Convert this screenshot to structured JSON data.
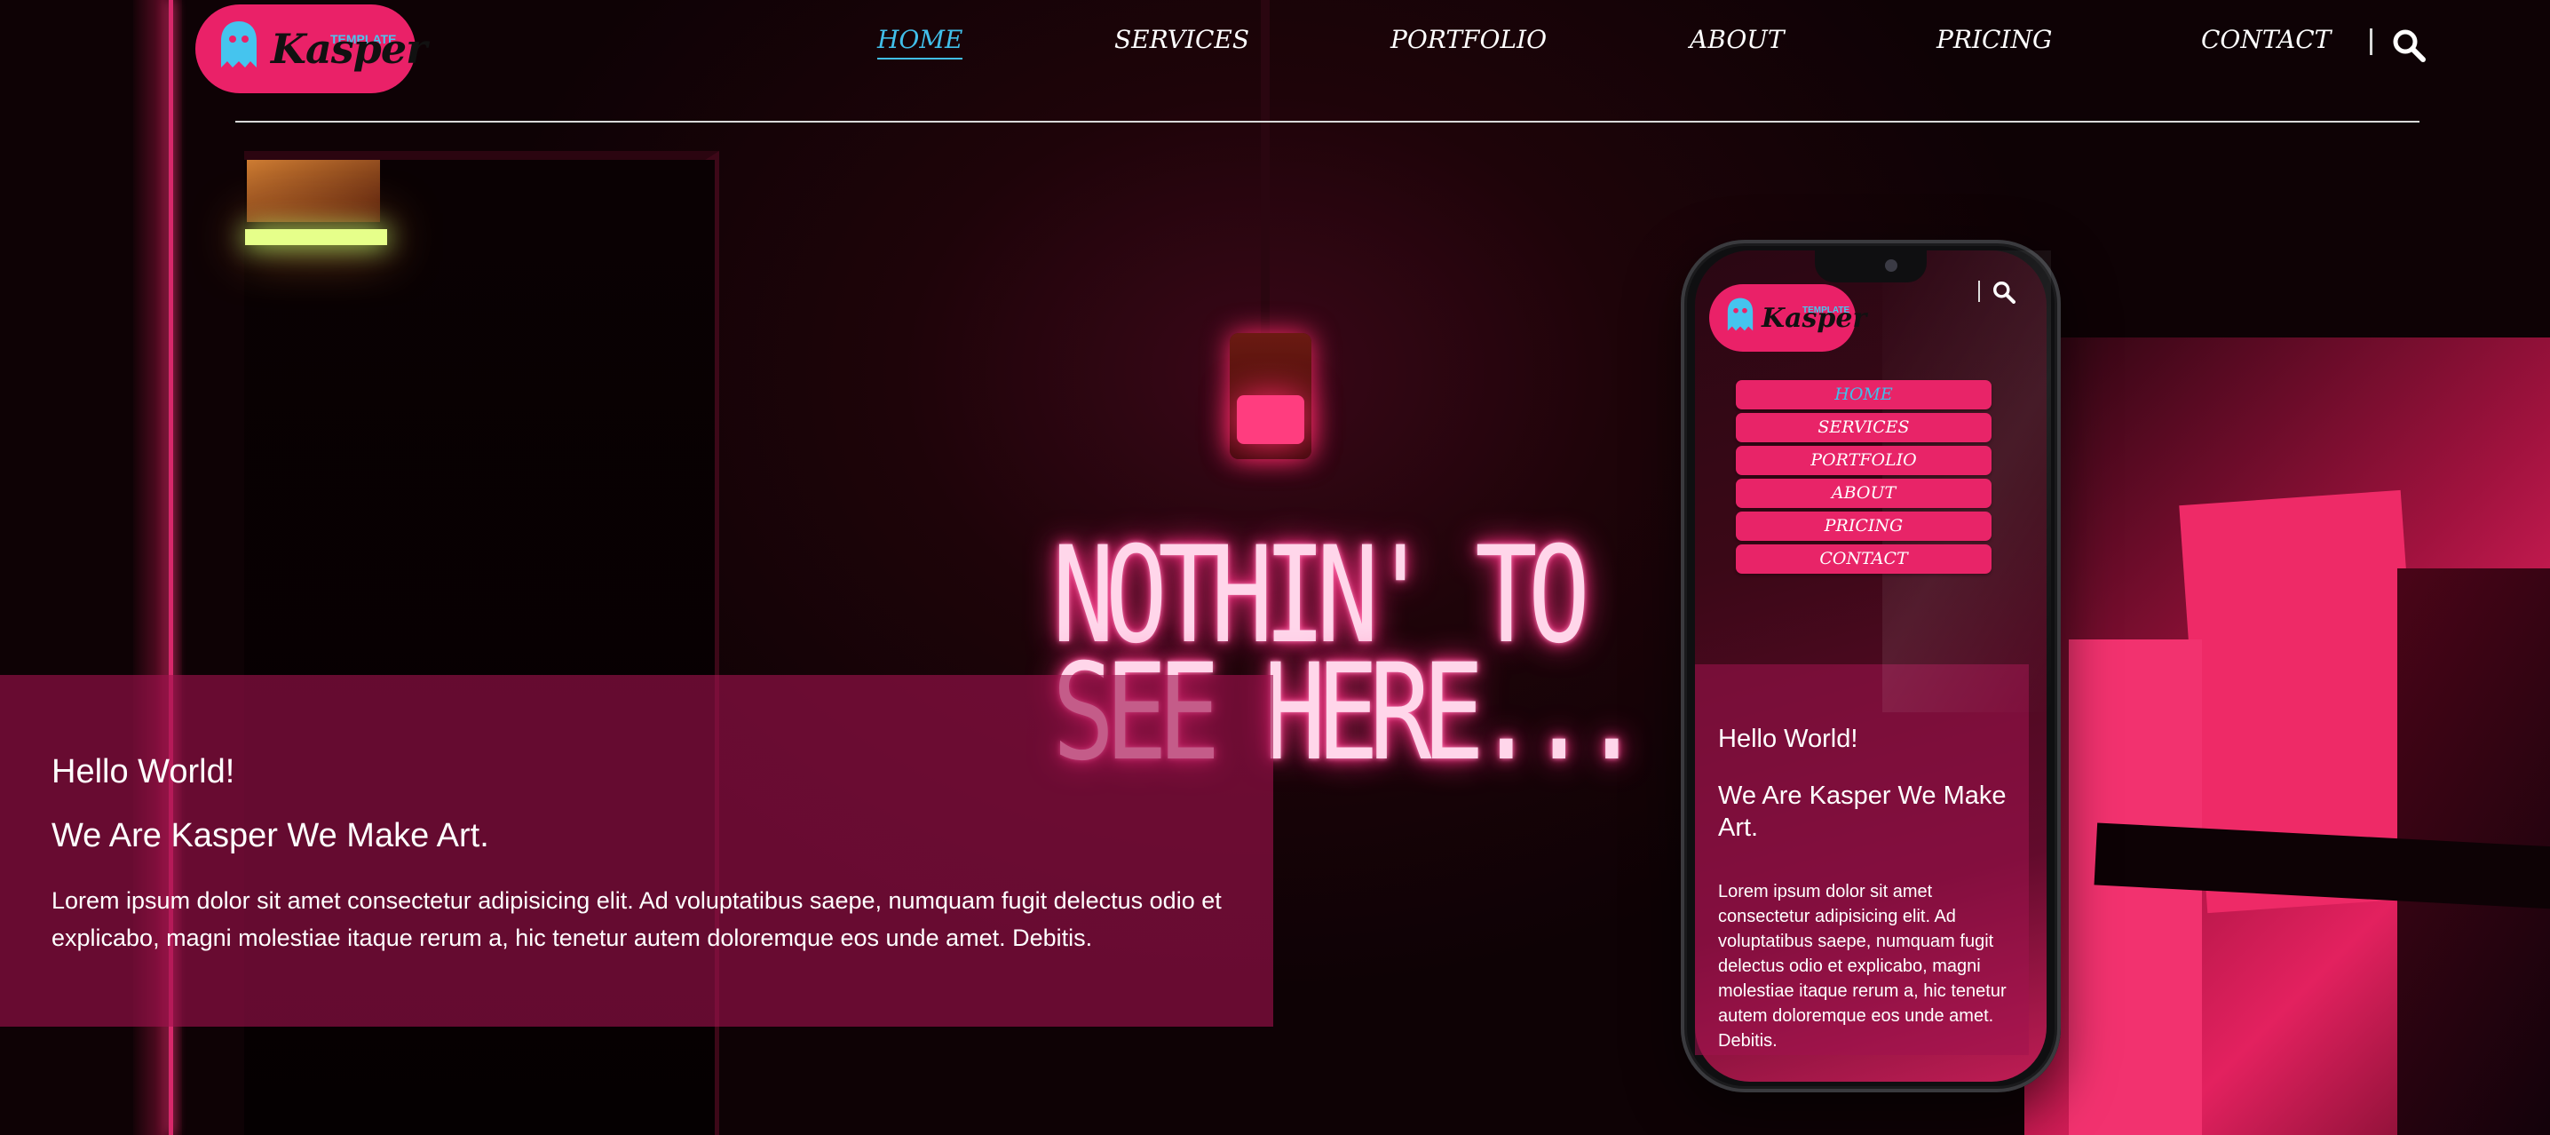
{
  "logo": {
    "name": "Kasper",
    "tag": "TEMPLATE"
  },
  "nav": {
    "items": [
      {
        "label": "HOME",
        "active": true
      },
      {
        "label": "SERVICES"
      },
      {
        "label": "PORTFOLIO"
      },
      {
        "label": "ABOUT"
      },
      {
        "label": "PRICING"
      },
      {
        "label": "CONTACT"
      }
    ],
    "search_icon": "search-icon"
  },
  "neon_sign": {
    "line1": "NOTHIN' TO",
    "line2": "SEE HERE..."
  },
  "intro": {
    "heading1": "Hello World!",
    "heading2": "We Are Kasper We Make Art.",
    "paragraph": "Lorem ipsum dolor sit amet consectetur adipisicing elit. Ad voluptatibus saepe, numquam fugit delectus odio et explicabo, magni molestiae itaque rerum a, hic tenetur autem doloremque eos unde amet. Debitis."
  },
  "phone": {
    "logo": {
      "name": "Kasper",
      "tag": "TEMPLATE"
    },
    "menu": [
      "HOME",
      "SERVICES",
      "PORTFOLIO",
      "ABOUT",
      "PRICING",
      "CONTACT"
    ],
    "heading1": "Hello World!",
    "heading2a": "We Are Kasper We Make",
    "heading2b": "Art.",
    "paragraph": "Lorem ipsum dolor sit amet consectetur adipisicing elit. Ad voluptatibus saepe, numquam fugit delectus odio et explicabo, magni molestiae itaque rerum a, hic tenetur autem doloremque eos unde amet. Debitis."
  },
  "colors": {
    "brand": "#ea2168",
    "accent": "#41bfea",
    "panel": "#a0124e"
  }
}
